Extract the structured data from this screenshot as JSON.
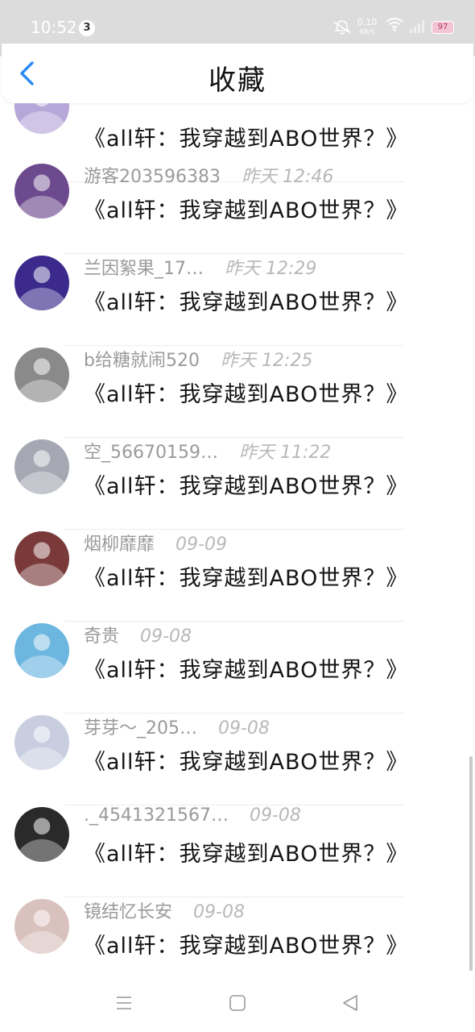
{
  "status_bar": {
    "time": "10:52",
    "notification_count": "3",
    "net_speed_value": "0.10",
    "net_speed_unit": "KB/S",
    "battery": "97"
  },
  "header": {
    "title": "收藏"
  },
  "items": [
    {
      "user": "",
      "time": "",
      "book": "《all轩：我穿越到ABO世界？》",
      "avatar_color": "#b7a6d8"
    },
    {
      "user": "游客203596383",
      "time": "昨天 12:46",
      "book": "《all轩：我穿越到ABO世界？》",
      "avatar_color": "#6d4a8e"
    },
    {
      "user": "兰因絮果_17…",
      "time": "昨天 12:29",
      "book": "《all轩：我穿越到ABO世界？》",
      "avatar_color": "#3b2a8c"
    },
    {
      "user": "b给糖就闹520",
      "time": "昨天 12:25",
      "book": "《all轩：我穿越到ABO世界？》",
      "avatar_color": "#8a8a8a"
    },
    {
      "user": "空_56670159…",
      "time": "昨天 11:22",
      "book": "《all轩：我穿越到ABO世界？》",
      "avatar_color": "#a5a8b3"
    },
    {
      "user": "烟柳靡靡",
      "time": "09-09",
      "book": "《all轩：我穿越到ABO世界？》",
      "avatar_color": "#7a3a3a"
    },
    {
      "user": "奇贵",
      "time": "09-08",
      "book": "《all轩：我穿越到ABO世界？》",
      "avatar_color": "#6cb6e0"
    },
    {
      "user": "芽芽～_205…",
      "time": "09-08",
      "book": "《all轩：我穿越到ABO世界？》",
      "avatar_color": "#c8cee0"
    },
    {
      "user": "._4541321567…",
      "time": "09-08",
      "book": "《all轩：我穿越到ABO世界？》",
      "avatar_color": "#2a2a2a"
    },
    {
      "user": "镜结忆长安",
      "time": "09-08",
      "book": "《all轩：我穿越到ABO世界？》",
      "avatar_color": "#d9c2bd"
    }
  ],
  "navbar": {
    "menu": "menu-icon",
    "home": "home-icon",
    "back": "back-icon"
  }
}
